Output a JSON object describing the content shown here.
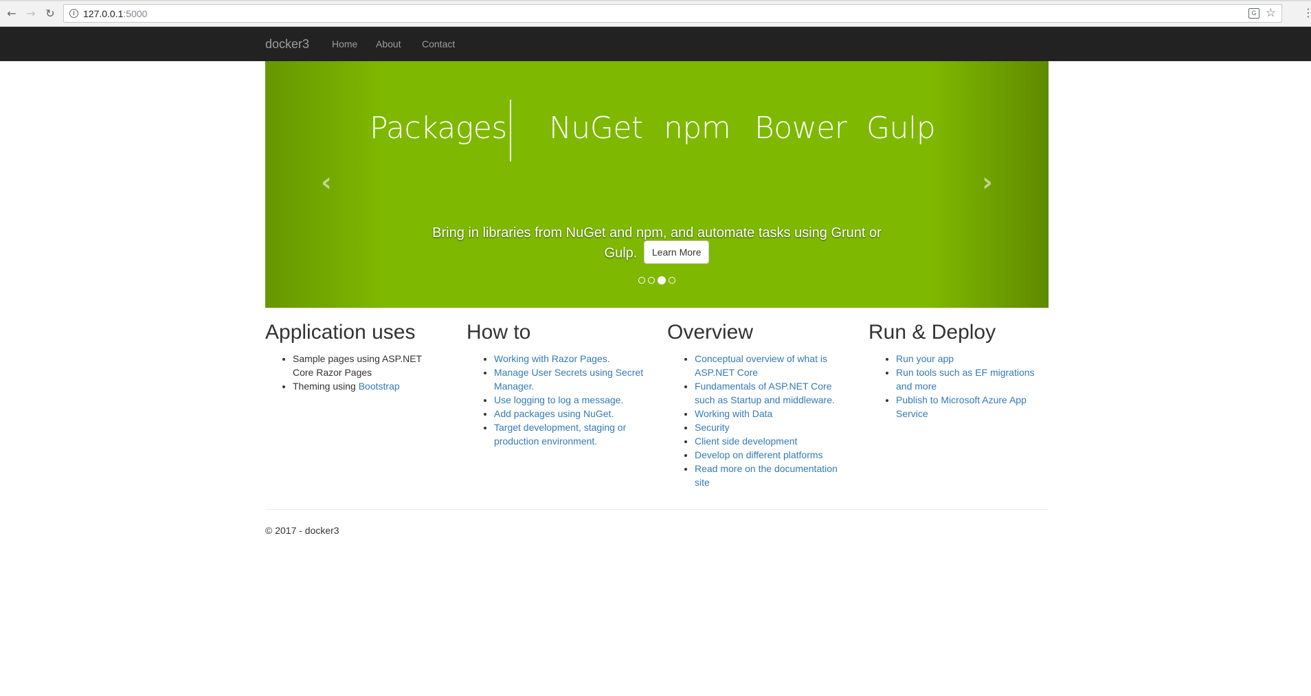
{
  "browser": {
    "url_host": "127.0.0.1",
    "url_port": ":5000",
    "back_icon": "arrow-left-icon",
    "forward_icon": "arrow-right-icon",
    "reload_icon": "reload-icon"
  },
  "navbar": {
    "brand": "docker3",
    "links": [
      "Home",
      "About",
      "Contact"
    ]
  },
  "carousel": {
    "banner_title": "Packages",
    "banner_items": [
      "NuGet",
      "npm",
      "Bower",
      "Gulp"
    ],
    "caption": "Bring in libraries from NuGet and npm, and automate tasks using Grunt or Gulp.",
    "button_label": "Learn More",
    "slide_count": 4,
    "active_slide": 3,
    "background_color": "#7fb800"
  },
  "columns": [
    {
      "heading": "Application uses",
      "items": [
        {
          "text": "Sample pages using ASP.NET Core Razor Pages",
          "link": false
        },
        {
          "prefix": "Theming using ",
          "text": "Bootstrap",
          "link": true
        }
      ]
    },
    {
      "heading": "How to",
      "items": [
        {
          "text": "Working with Razor Pages.",
          "link": true
        },
        {
          "text": "Manage User Secrets using Secret Manager.",
          "link": true
        },
        {
          "text": "Use logging to log a message.",
          "link": true
        },
        {
          "text": "Add packages using NuGet.",
          "link": true
        },
        {
          "text": "Target development, staging or production environment.",
          "link": true
        }
      ]
    },
    {
      "heading": "Overview",
      "items": [
        {
          "text": "Conceptual overview of what is ASP.NET Core",
          "link": true
        },
        {
          "text": "Fundamentals of ASP.NET Core such as Startup and middleware.",
          "link": true
        },
        {
          "text": "Working with Data",
          "link": true
        },
        {
          "text": "Security",
          "link": true
        },
        {
          "text": "Client side development",
          "link": true
        },
        {
          "text": "Develop on different platforms",
          "link": true
        },
        {
          "text": "Read more on the documentation site",
          "link": true
        }
      ]
    },
    {
      "heading": "Run & Deploy",
      "items": [
        {
          "text": "Run your app",
          "link": true
        },
        {
          "text": "Run tools such as EF migrations and more",
          "link": true
        },
        {
          "text": "Publish to Microsoft Azure App Service",
          "link": true
        }
      ]
    }
  ],
  "footer": "© 2017 - docker3",
  "colors": {
    "navbar_bg": "#222222",
    "link": "#337ab7",
    "text": "#333333"
  }
}
